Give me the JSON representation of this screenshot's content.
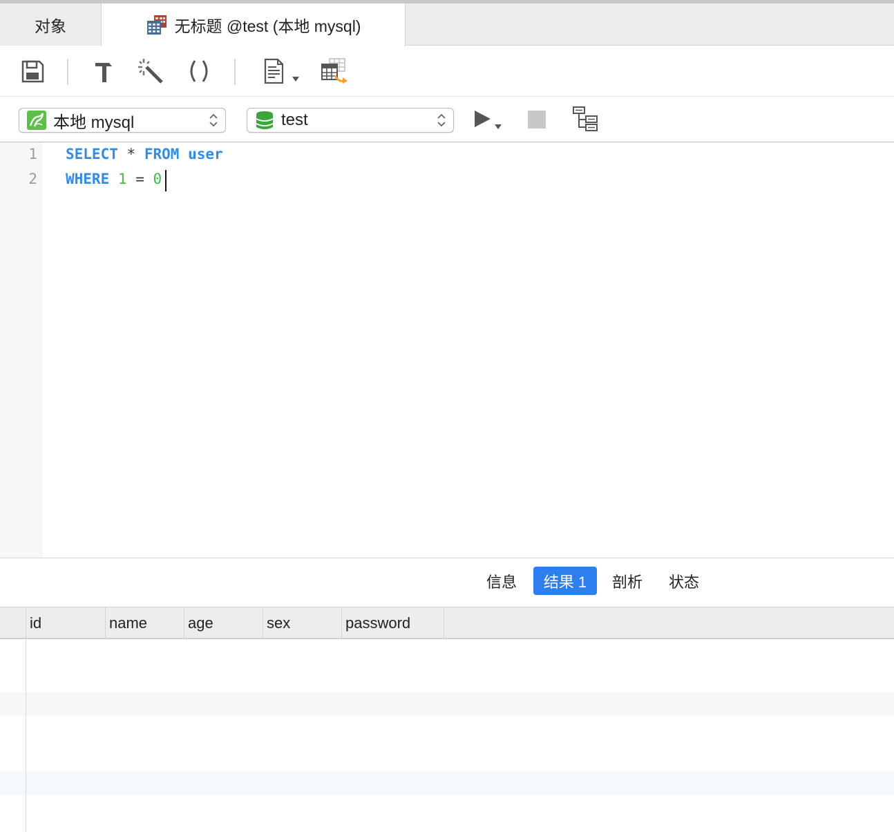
{
  "tabs": {
    "objects_label": "对象",
    "query_label": "无标题 @test (本地 mysql)"
  },
  "toolbar": {
    "buttons": [
      "save-icon",
      "hammer-icon",
      "magic-wand-icon",
      "parentheses-icon",
      "text-document-icon",
      "table-export-icon"
    ]
  },
  "connection": {
    "server": "本地 mysql",
    "database": "test"
  },
  "editor": {
    "line_numbers": [
      "1",
      "2"
    ],
    "line1": {
      "kw1": "SELECT",
      "star": "*",
      "kw2": "FROM",
      "table": "user"
    },
    "line2": {
      "kw1": "WHERE",
      "n1": "1",
      "eq": "=",
      "n2": "0"
    }
  },
  "result_tabs": [
    {
      "label": "信息",
      "active": false
    },
    {
      "label": "结果 1",
      "active": true
    },
    {
      "label": "剖析",
      "active": false
    },
    {
      "label": "状态",
      "active": false
    }
  ],
  "grid": {
    "columns": [
      "id",
      "name",
      "age",
      "sex",
      "password"
    ]
  },
  "colors": {
    "keyword": "#2f8ce8",
    "number": "#43b948",
    "active_tab": "#2d7ff0"
  }
}
